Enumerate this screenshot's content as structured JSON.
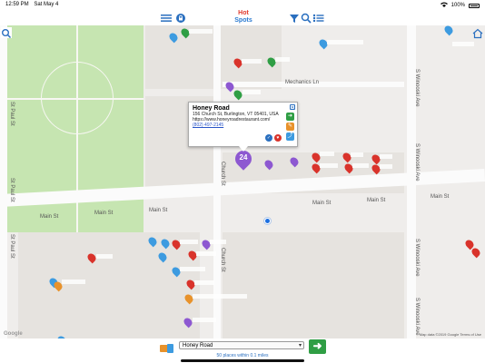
{
  "status": {
    "time": "12:59 PM",
    "date": "Sat May 4",
    "battery": "100%"
  },
  "header": {
    "logo_top": "Hot",
    "logo_bottom": "Spots"
  },
  "icons": {
    "menu": "menu-icon",
    "lock": "lock-icon",
    "filter": "filter-icon",
    "search": "search-icon",
    "list": "list-icon",
    "home": "home-icon"
  },
  "map": {
    "streets": {
      "main_st": "Main St",
      "mechanics_ln": "Mechanics Ln",
      "church_st": "Church St",
      "st_paul_st": "St Paul St",
      "s_winooski_ave": "S Winooski Ave"
    },
    "popup": {
      "title": "Honey Road",
      "address": "156 Church St, Burlington, VT 05401, USA",
      "url": "https://www.honeyroadrestaurant.com/",
      "phone": "(802) 497-2145"
    },
    "cluster_count": "24",
    "attribution": "Map data ©2019 Google   Terms of Use",
    "google": "Google"
  },
  "footer": {
    "selected_place": "Honey Road",
    "places_within": "50 places within 0.1 miles"
  },
  "colors": {
    "accent": "#2a6fbf",
    "go": "#2f9e44",
    "pin_red": "#d9332b",
    "pin_green": "#2f9e44",
    "pin_purple": "#8d58d1",
    "pin_blue": "#3d9be0",
    "pin_orange": "#e8922b"
  }
}
